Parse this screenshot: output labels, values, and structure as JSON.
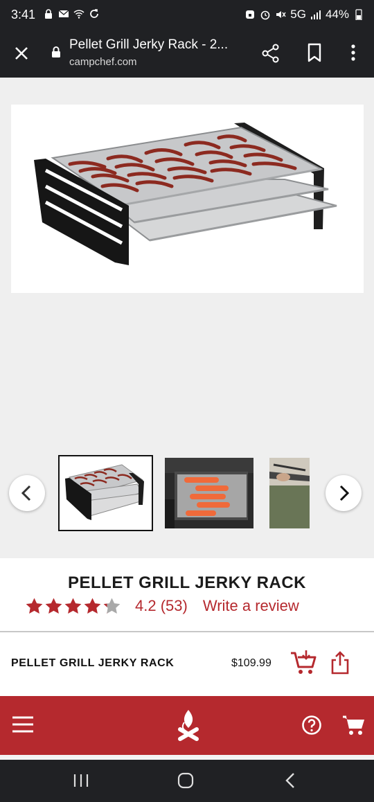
{
  "status_bar": {
    "time": "3:41",
    "network": "5G",
    "battery": "44%"
  },
  "browser": {
    "page_title": "Pellet Grill Jerky Rack - 2...",
    "url": "campchef.com"
  },
  "gallery": {
    "thumbnails": [
      "jerky-rack-product",
      "rack-in-grill-with-salmon",
      "person-using-tongs"
    ]
  },
  "product": {
    "title": "PELLET GRILL JERKY RACK",
    "rating_stars": 4.2,
    "rating_text": "4.2 (53)",
    "review_link": "Write a review"
  },
  "buy_bar": {
    "name": "PELLET GRILL JERKY RACK",
    "price": "$109.99"
  },
  "colors": {
    "brand_red": "#b5292e",
    "dark_bar": "#202124",
    "gallery_bg": "#efefef"
  },
  "icons": {
    "nav_menu": "hamburger-menu-icon",
    "nav_logo": "campfire-logo-icon",
    "nav_help": "help-icon",
    "nav_cart": "cart-icon"
  }
}
